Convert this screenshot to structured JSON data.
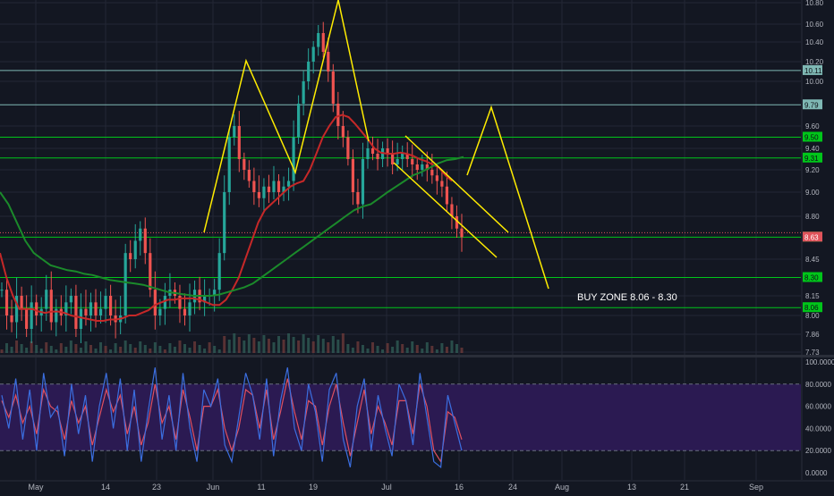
{
  "colors": {
    "background": "#131722",
    "grid": "#232735",
    "axis_text": "#b2b5be",
    "price_line_green": "#00c51a",
    "price_line_teal": "#7fb8b4",
    "current_price": "#e0535b",
    "ma_red": "#c62828",
    "ma_green": "#1b8a2b",
    "pattern_yellow": "#ffec00",
    "candle_up": "#26a69a",
    "candle_down": "#ef5350",
    "stoch_band": "#2b1a52",
    "stoch_k": "#3b6ee0",
    "stoch_d": "#e05060"
  },
  "chart_data": [
    {
      "type": "line",
      "title": "",
      "annotation": "BUY ZONE 8.06 - 8.30",
      "price_axis_ticks": [
        "10.80",
        "10.60",
        "10.40",
        "10.20",
        "10.00",
        "9.60",
        "9.40",
        "9.20",
        "9.00",
        "8.80",
        "8.45",
        "8.15",
        "8.00",
        "7.86",
        "7.73"
      ],
      "time_axis_labels": [
        "May",
        "14",
        "23",
        "Jun",
        "11",
        "19",
        "Jul",
        "16",
        "24",
        "Aug",
        "13",
        "21",
        "Sep"
      ],
      "horizontal_levels": [
        {
          "price": 10.11,
          "label": "10.11",
          "color": "teal"
        },
        {
          "price": 9.79,
          "label": "9.79",
          "color": "teal"
        },
        {
          "price": 9.5,
          "label": "9.50",
          "color": "green"
        },
        {
          "price": 9.31,
          "label": "9.31",
          "color": "green"
        },
        {
          "price": 8.63,
          "label": "8.63",
          "color": "green"
        },
        {
          "price": 8.3,
          "label": "8.30",
          "color": "green"
        },
        {
          "price": 8.06,
          "label": "8.06",
          "color": "green"
        }
      ],
      "current_price": {
        "value": 8.63,
        "label": "8.63"
      },
      "ylim": [
        7.73,
        10.85
      ],
      "grid": true,
      "series": [
        {
          "kind": "close",
          "values": [
            8.2,
            8.0,
            7.95,
            8.15,
            8.05,
            7.9,
            8.1,
            8.0,
            8.05,
            8.2,
            7.95,
            8.05,
            8.0,
            8.1,
            8.15,
            7.9,
            8.05,
            8.0,
            8.1,
            8.0,
            8.05,
            8.15,
            8.0,
            7.95,
            8.0,
            8.5,
            8.45,
            8.6,
            8.7,
            8.5,
            8.2,
            8.0,
            8.05,
            8.15,
            8.2,
            8.15,
            8.05,
            8.0,
            8.1,
            8.2,
            8.1,
            8.15,
            8.15,
            8.2,
            8.5,
            9.0,
            9.5,
            9.6,
            9.3,
            9.2,
            9.1,
            9.0,
            8.95,
            9.05,
            9.0,
            9.1,
            9.0,
            9.05,
            9.1,
            9.5,
            9.8,
            10.0,
            10.2,
            10.35,
            10.5,
            10.3,
            10.1,
            9.8,
            9.6,
            9.5,
            9.3,
            9.0,
            8.9,
            9.3,
            9.4,
            9.35,
            9.3,
            9.4,
            9.35,
            9.25,
            9.3,
            9.35,
            9.3,
            9.25,
            9.2,
            9.25,
            9.2,
            9.15,
            9.1,
            9.05,
            8.9,
            8.8,
            8.7,
            8.63
          ]
        },
        {
          "kind": "ma_red",
          "values": [
            8.5,
            8.3,
            8.15,
            8.05,
            8.05,
            8.05,
            8.03,
            8.02,
            8.03,
            8.03,
            8.02,
            8.0,
            7.99,
            7.98,
            7.97,
            7.96,
            7.96,
            7.97,
            7.97,
            7.98,
            8.0,
            8.0,
            8.02,
            8.04,
            8.08,
            8.1,
            8.12,
            8.12,
            8.13,
            8.13,
            8.13,
            8.12,
            8.1,
            8.08,
            8.08,
            8.12,
            8.2,
            8.3,
            8.45,
            8.6,
            8.75,
            8.85,
            8.9,
            8.95,
            9.0,
            9.05,
            9.08,
            9.1,
            9.2,
            9.35,
            9.5,
            9.6,
            9.68,
            9.7,
            9.68,
            9.62,
            9.55,
            9.48,
            9.4,
            9.36,
            9.35,
            9.35,
            9.36,
            9.35,
            9.33,
            9.3,
            9.28,
            9.25,
            9.22,
            9.15,
            9.1
          ]
        },
        {
          "kind": "ma_green",
          "values": [
            9.0,
            8.9,
            8.75,
            8.6,
            8.5,
            8.45,
            8.4,
            8.38,
            8.36,
            8.35,
            8.33,
            8.32,
            8.3,
            8.28,
            8.27,
            8.26,
            8.25,
            8.24,
            8.22,
            8.2,
            8.18,
            8.17,
            8.16,
            8.15,
            8.15,
            8.15,
            8.16,
            8.18,
            8.2,
            8.22,
            8.25,
            8.3,
            8.35,
            8.4,
            8.45,
            8.5,
            8.55,
            8.6,
            8.65,
            8.7,
            8.75,
            8.8,
            8.85,
            8.88,
            8.9,
            8.95,
            9.0,
            9.05,
            9.1,
            9.15,
            9.18,
            9.22,
            9.26,
            9.29,
            9.3,
            9.32
          ]
        }
      ]
    },
    {
      "type": "line",
      "title": "",
      "y_axis_ticks": [
        "100.0000",
        "80.0000",
        "60.0000",
        "40.0000",
        "20.0000",
        "0.0000"
      ],
      "ylim": [
        0,
        100
      ],
      "band": [
        20,
        80
      ],
      "series": [
        {
          "kind": "k",
          "values": [
            70,
            40,
            85,
            30,
            75,
            20,
            90,
            50,
            60,
            15,
            80,
            35,
            70,
            10,
            60,
            90,
            40,
            85,
            20,
            75,
            10,
            55,
            95,
            30,
            70,
            20,
            90,
            40,
            10,
            75,
            60,
            85,
            25,
            10,
            50,
            90,
            70,
            30,
            85,
            15,
            65,
            95,
            40,
            20,
            80,
            55,
            10,
            75,
            90,
            30,
            5,
            60,
            85,
            20,
            70,
            40,
            15,
            80,
            65,
            25,
            90,
            50,
            10,
            5,
            70,
            45,
            20
          ]
        },
        {
          "kind": "d",
          "values": [
            65,
            50,
            70,
            45,
            60,
            35,
            75,
            60,
            55,
            30,
            65,
            45,
            60,
            25,
            50,
            75,
            55,
            70,
            35,
            60,
            25,
            45,
            80,
            45,
            60,
            30,
            75,
            50,
            20,
            60,
            60,
            75,
            40,
            20,
            40,
            75,
            70,
            40,
            75,
            30,
            55,
            85,
            55,
            30,
            65,
            60,
            25,
            60,
            80,
            45,
            15,
            45,
            75,
            35,
            60,
            45,
            25,
            65,
            65,
            35,
            80,
            60,
            20,
            10,
            55,
            50,
            30
          ]
        }
      ]
    }
  ]
}
